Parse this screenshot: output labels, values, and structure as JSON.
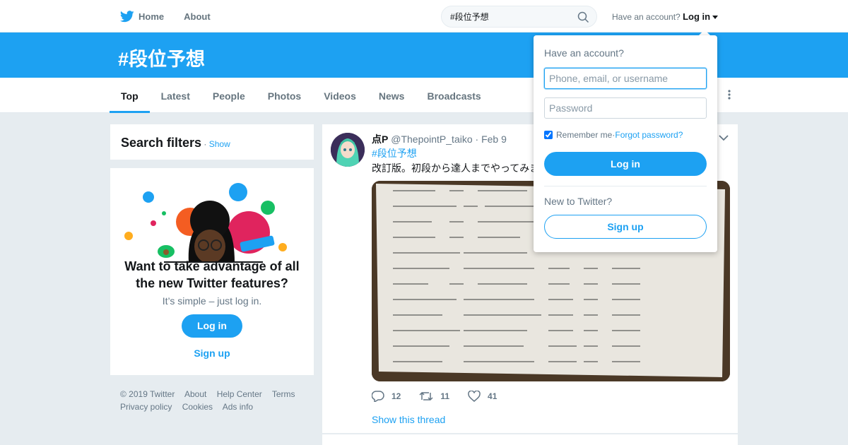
{
  "nav": {
    "home_label": "Home",
    "about_label": "About",
    "search_value": "#段位予想",
    "have_account_text": "Have an account?",
    "login_label": "Log in"
  },
  "header": {
    "title": "#段位予想"
  },
  "tabs": [
    {
      "label": "Top",
      "active": true
    },
    {
      "label": "Latest"
    },
    {
      "label": "People"
    },
    {
      "label": "Photos"
    },
    {
      "label": "Videos"
    },
    {
      "label": "News"
    },
    {
      "label": "Broadcasts"
    }
  ],
  "sidebar": {
    "filters_title": "Search filters",
    "filters_dot": " · ",
    "filters_show": "Show",
    "promo_heading": "Want to take advantage of all the new Twitter features?",
    "promo_sub": "It’s simple – just log in.",
    "promo_login": "Log in",
    "promo_signup": "Sign up"
  },
  "footer": [
    "© 2019 Twitter",
    "About",
    "Help Center",
    "Terms",
    "Privacy policy",
    "Cookies",
    "Ads info"
  ],
  "tweet": {
    "name": "点P",
    "handle": "@ThepointP_taiko",
    "sep": " · ",
    "date": "Feb 9",
    "hashtag": "#段位予想",
    "text": "改訂版。初段から達人までやってみま",
    "photo_alt": "handwritten list of songs on paper",
    "replies": "12",
    "retweets": "11",
    "likes": "41",
    "show_thread": "Show this thread"
  },
  "login_dropdown": {
    "title": "Have an account?",
    "username_placeholder": "Phone, email, or username",
    "password_placeholder": "Password",
    "remember_label": "Remember me",
    "dot": " · ",
    "forgot_label": "Forgot password?",
    "login_button": "Log in",
    "new_text": "New to Twitter?",
    "signup_button": "Sign up"
  },
  "colors": {
    "brand": "#1da1f2",
    "background": "#e6ecf0"
  }
}
